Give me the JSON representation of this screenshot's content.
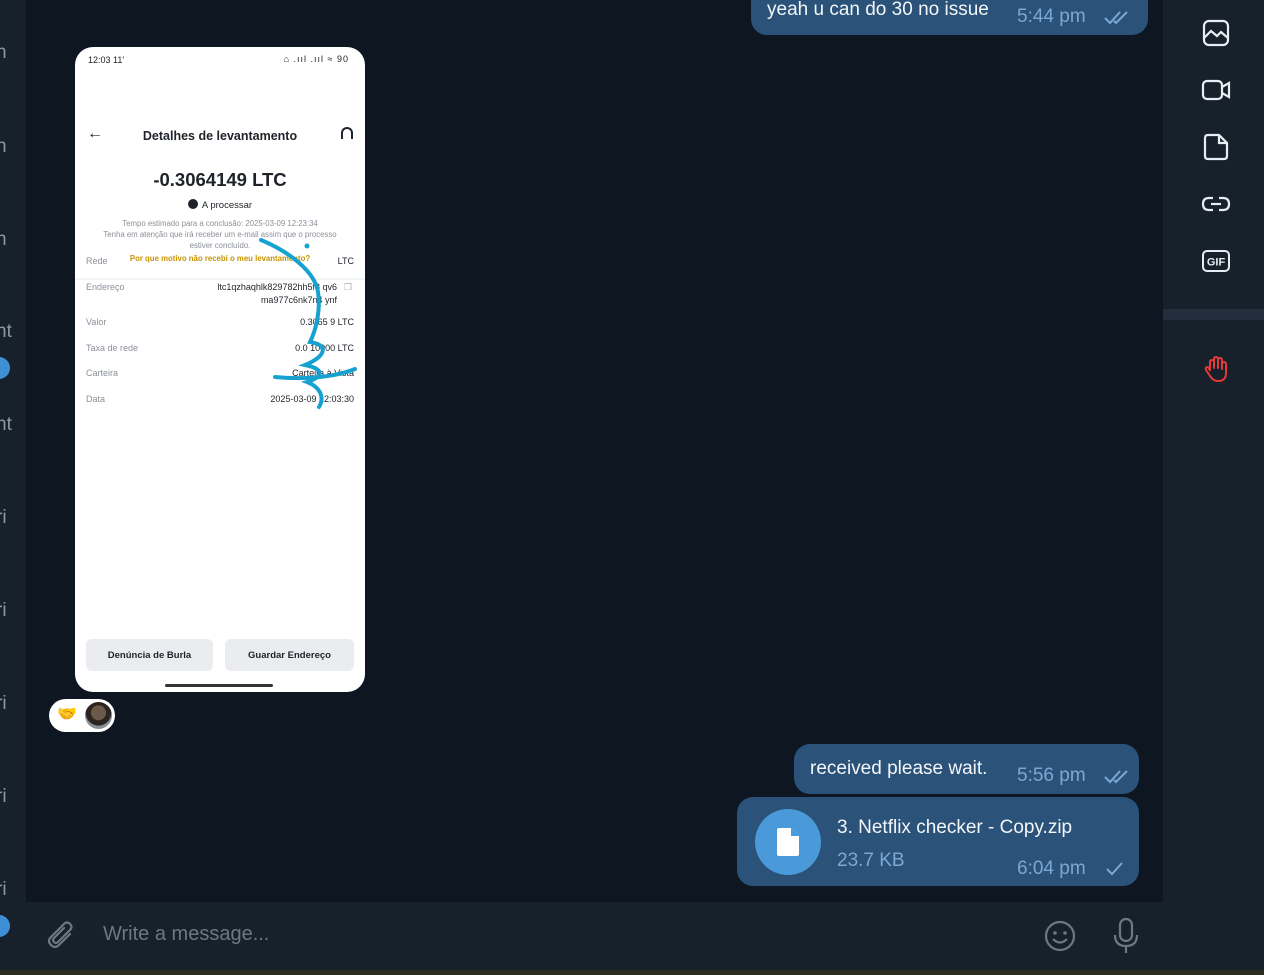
{
  "left_strip": {
    "letters": [
      "n",
      "n",
      "n",
      "nt",
      "nt",
      "ri",
      "ri",
      "ri",
      "ri",
      "ri"
    ]
  },
  "right_panel": {
    "icons": [
      "photo-icon",
      "video-icon",
      "file-icon",
      "link-icon",
      "gif-icon",
      "hand-icon"
    ],
    "gif_label": "GIF",
    "colors": {
      "icon": "#e8edf2",
      "hand": "#e53935"
    }
  },
  "messages": {
    "top": {
      "text": "yeah u can do 30 no issue",
      "time": "5:44 pm"
    },
    "received": {
      "text": "received please wait.",
      "time": "5:56 pm"
    },
    "file": {
      "name": "3. Netflix checker - Copy.zip",
      "size": "23.7 KB",
      "time": "6:04 pm"
    }
  },
  "screenshot": {
    "status_time": "12:03",
    "status_extra": "11'",
    "status_icons": "⌂ .ııl .ııl ≈ 90",
    "title": "Detalhes de levantamento",
    "amount": "-0.3064149 LTC",
    "status": "A processar",
    "note_line1": "Tempo estimado para a conclusão: 2025-03-09 12:23:34",
    "note_line2": "Tenha em atenção que irá receber um e-mail assim que o processo",
    "note_line3": "estiver concluído.",
    "note_link": "Por que motivo não recebi o meu levantamento?",
    "rows": [
      {
        "label": "Rede",
        "value": "LTC"
      },
      {
        "label": "Endereço",
        "value": "ltc1qzhaqhlk829782hh5f8 qv6",
        "value2": "ma977c6nk7n4 ynf"
      },
      {
        "label": "Valor",
        "value": "0.3065 9 LTC"
      },
      {
        "label": "Taxa de rede",
        "value": "0.0 10000 LTC"
      },
      {
        "label": "Carteira",
        "value": "Carteira à Vista"
      },
      {
        "label": "Data",
        "value": "2025-03-09 12:03:30"
      }
    ],
    "button_report": "Denúncia de Burla",
    "button_save": "Guardar Endereço"
  },
  "reactions": {
    "emoji": "🤝"
  },
  "input": {
    "placeholder": "Write a message..."
  },
  "colors": {
    "bubble": "#2b5278",
    "background": "#0e1621",
    "panel": "#17212b",
    "time": "#7da8d3",
    "accent": "#4a9ad9",
    "scribble": "#16a2d0"
  }
}
